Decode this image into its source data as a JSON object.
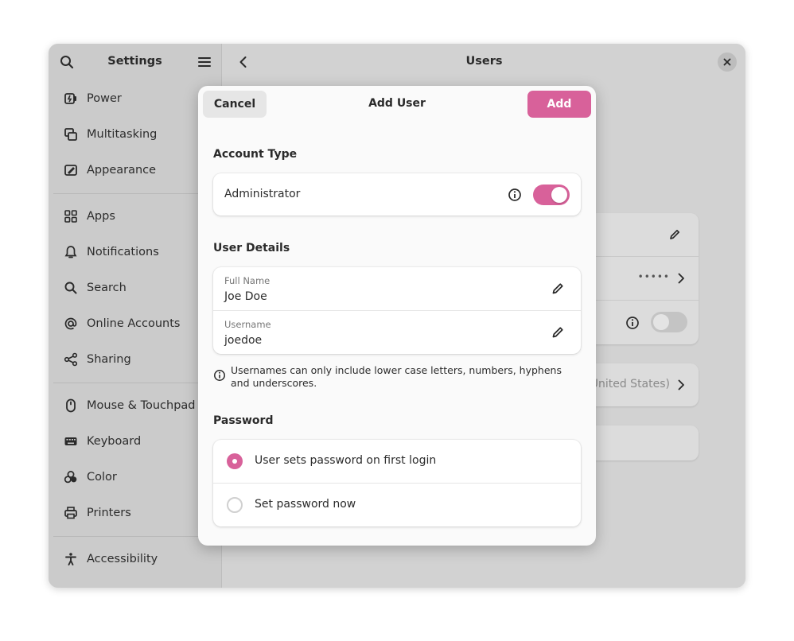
{
  "sidebar": {
    "title": "Settings",
    "items": [
      {
        "label": "Power",
        "icon": "power-icon"
      },
      {
        "label": "Multitasking",
        "icon": "multitasking-icon"
      },
      {
        "label": "Appearance",
        "icon": "appearance-icon"
      },
      {
        "label": "Apps",
        "icon": "apps-icon"
      },
      {
        "label": "Notifications",
        "icon": "bell-icon"
      },
      {
        "label": "Search",
        "icon": "search-icon"
      },
      {
        "label": "Online Accounts",
        "icon": "at-icon"
      },
      {
        "label": "Sharing",
        "icon": "share-icon"
      },
      {
        "label": "Mouse & Touchpad",
        "icon": "mouse-icon"
      },
      {
        "label": "Keyboard",
        "icon": "keyboard-icon"
      },
      {
        "label": "Color",
        "icon": "color-icon"
      },
      {
        "label": "Printers",
        "icon": "printer-icon"
      },
      {
        "label": "Accessibility",
        "icon": "accessibility-icon"
      }
    ]
  },
  "content": {
    "title": "Users",
    "password_dots": "•••••",
    "language_partial": "United States)"
  },
  "dialog": {
    "title": "Add User",
    "cancel_label": "Cancel",
    "add_label": "Add",
    "account_type": {
      "section_title": "Account Type",
      "administrator_label": "Administrator",
      "administrator_enabled": true
    },
    "user_details": {
      "section_title": "User Details",
      "full_name_label": "Full Name",
      "full_name_value": "Joe Doe",
      "username_label": "Username",
      "username_value": "joedoe",
      "hint": "Usernames can only include lower case letters, numbers, hyphens and underscores."
    },
    "password": {
      "section_title": "Password",
      "options": [
        {
          "label": "User sets password on first login",
          "selected": true
        },
        {
          "label": "Set password now",
          "selected": false
        }
      ]
    }
  },
  "colors": {
    "accent": "#d8619a",
    "window_dimmed": "#d2d2d2",
    "dialog_bg": "#fafafa"
  }
}
